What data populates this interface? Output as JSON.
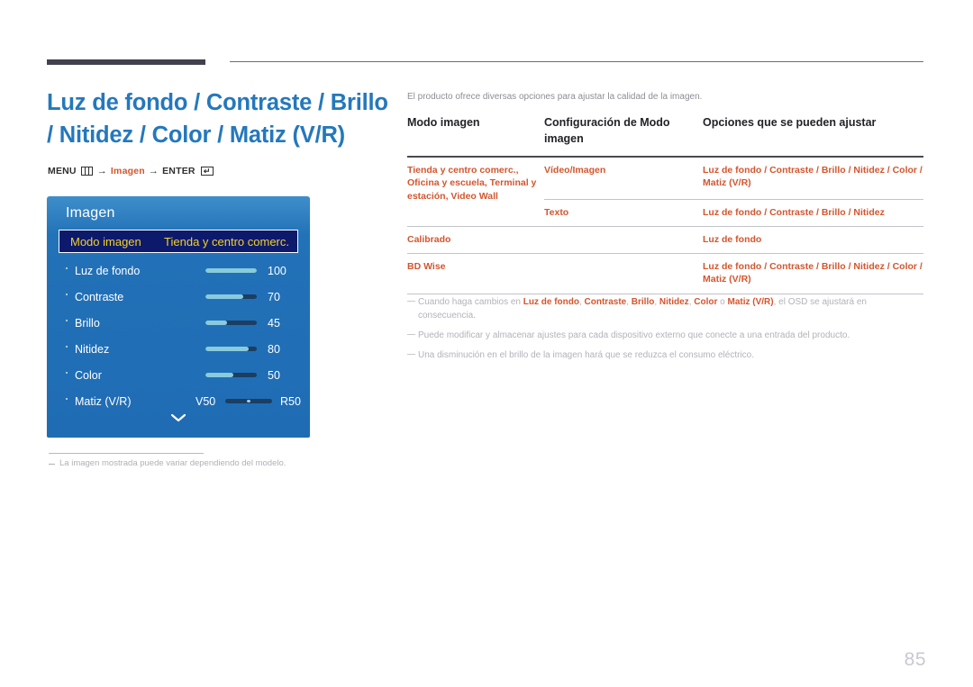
{
  "page": {
    "number": "85"
  },
  "header": {
    "title": "Luz de fondo / Contraste / Brillo / Nitidez / Color / Matiz (V/R)",
    "breadcrumb": {
      "menu_label": "MENU",
      "menu_icon": "menu-grid-icon",
      "arrow": "→",
      "middle_label": "Imagen",
      "enter_label": "ENTER",
      "enter_icon": "enter-key-icon"
    }
  },
  "osd": {
    "panel_title": "Imagen",
    "selected": {
      "label": "Modo imagen",
      "value": "Tienda y centro comerc."
    },
    "rows": [
      {
        "label": "Luz de fondo",
        "value": "100",
        "fill_pct": 100
      },
      {
        "label": "Contraste",
        "value": "70",
        "fill_pct": 73
      },
      {
        "label": "Brillo",
        "value": "45",
        "fill_pct": 42
      },
      {
        "label": "Nitidez",
        "value": "80",
        "fill_pct": 85
      },
      {
        "label": "Color",
        "value": "50",
        "fill_pct": 55
      }
    ],
    "matiz": {
      "label": "Matiz (V/R)",
      "left_value": "V50",
      "right_value": "R50",
      "knob_pct": 50
    },
    "more_icon": "chevron-down-icon"
  },
  "left_note": {
    "text": "La imagen mostrada puede variar dependiendo del modelo."
  },
  "main": {
    "intro": "El producto ofrece diversas opciones para ajustar la calidad de la imagen.",
    "table": {
      "headers": [
        "Modo imagen",
        "Configuración de Modo imagen",
        "Opciones que se pueden ajustar"
      ],
      "rows": [
        {
          "mode": "Tienda y centro comerc., Oficina y escuela, Terminal y estación, Video Wall",
          "subrows": [
            {
              "config": "Vídeo/Imagen",
              "options": "Luz de fondo / Contraste / Brillo / Nitidez / Color / Matiz (V/R)"
            },
            {
              "config": "Texto",
              "options": "Luz de fondo / Contraste / Brillo / Nitidez"
            }
          ]
        },
        {
          "mode": "Calibrado",
          "subrows": [
            {
              "config": "",
              "options": "Luz de fondo"
            }
          ]
        },
        {
          "mode": "BD Wise",
          "subrows": [
            {
              "config": "",
              "options": "Luz de fondo / Contraste / Brillo / Nitidez / Color / Matiz (V/R)"
            }
          ]
        }
      ]
    },
    "notes": [
      {
        "parts": [
          {
            "t": "Cuando haga cambios en ",
            "accent": false
          },
          {
            "t": "Luz de fondo",
            "accent": true
          },
          {
            "t": ", ",
            "accent": false
          },
          {
            "t": "Contraste",
            "accent": true
          },
          {
            "t": ", ",
            "accent": false
          },
          {
            "t": "Brillo",
            "accent": true
          },
          {
            "t": ", ",
            "accent": false
          },
          {
            "t": "Nitidez",
            "accent": true
          },
          {
            "t": ", ",
            "accent": false
          },
          {
            "t": "Color",
            "accent": true
          },
          {
            "t": " o ",
            "accent": false
          },
          {
            "t": "Matiz (V/R)",
            "accent": true
          },
          {
            "t": ", el OSD se ajustará en consecuencia.",
            "accent": false
          }
        ]
      },
      {
        "parts": [
          {
            "t": "Puede modificar y almacenar ajustes para cada dispositivo externo que conecte a una entrada del producto.",
            "accent": false
          }
        ]
      },
      {
        "parts": [
          {
            "t": "Una disminución en el brillo de la imagen hará que se reduzca el consumo eléctrico.",
            "accent": false
          }
        ]
      }
    ]
  },
  "colors": {
    "title_blue": "#2478bd",
    "accent_orange": "#d4552e",
    "osd_blue": "#1f6cb4",
    "osd_selected_bg": "#0d1a6b",
    "osd_selected_text": "#f2d02c",
    "slider_fill": "#89cbdd",
    "slider_track": "#1b3e62",
    "muted_text": "#b2b2bb",
    "rule_dark": "#43414f"
  }
}
